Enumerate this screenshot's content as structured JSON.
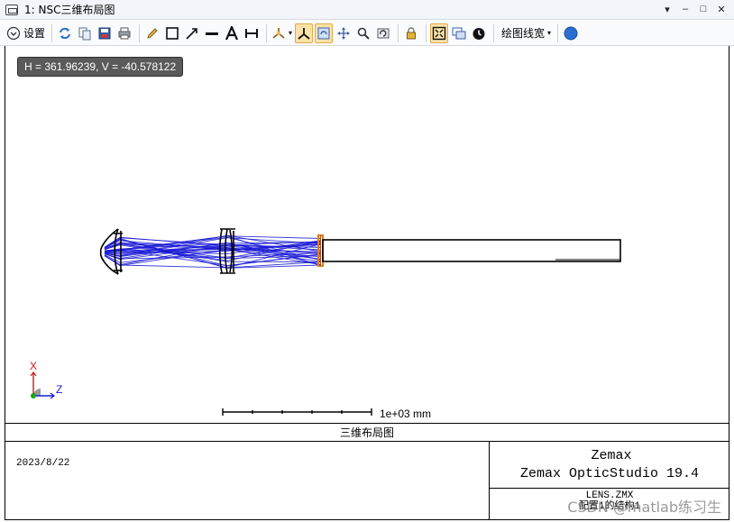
{
  "window": {
    "title": "1: NSC三维布局图",
    "controls": {
      "dropdown": "▾",
      "minimize": "–",
      "maximize": "□",
      "close": "✕"
    }
  },
  "toolbar": {
    "settings_label": "设置",
    "line_width_label": "绘图线宽",
    "help_glyph": "?"
  },
  "canvas": {
    "coordinates": "H = 361.96239, V = -40.578122",
    "axis_x_label": "X",
    "axis_z_label": "Z",
    "scale_label": "1e+03 mm",
    "colors": {
      "rays": "#1a1ad6",
      "outline": "#000000",
      "detector": "#e07b1a"
    }
  },
  "footer": {
    "title": "三维布局图",
    "date": "2023/8/22",
    "company_line1": "Zemax",
    "company_line2": "Zemax OpticStudio 19.4",
    "file_name": "LENS.ZMX",
    "config_label": "配置1的结构1"
  },
  "watermark": "CSDN @matlab练习生"
}
